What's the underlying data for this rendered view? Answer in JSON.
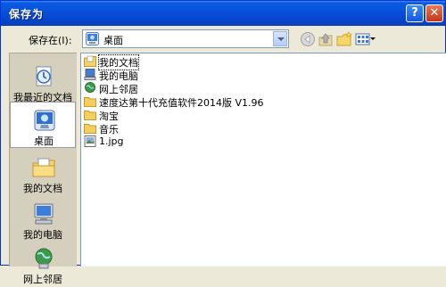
{
  "window": {
    "title": "保存为",
    "help_label": "?",
    "close_label": "✕"
  },
  "toolbar": {
    "lookin_label": "保存在(I):",
    "lookin_value": "桌面",
    "icons": [
      "back-icon",
      "up-folder-icon",
      "new-folder-icon",
      "views-menu-icon"
    ]
  },
  "places": [
    {
      "label": "我最近的文档",
      "icon": "recent-documents-icon"
    },
    {
      "label": "桌面",
      "icon": "desktop-icon",
      "selected": true
    },
    {
      "label": "我的文档",
      "icon": "my-documents-icon"
    },
    {
      "label": "我的电脑",
      "icon": "my-computer-icon"
    },
    {
      "label": "网上邻居",
      "icon": "network-places-icon"
    }
  ],
  "files": [
    {
      "label": "我的文档",
      "icon": "my-documents-folder-icon"
    },
    {
      "label": "我的电脑",
      "icon": "my-computer-icon"
    },
    {
      "label": "网上邻居",
      "icon": "network-places-icon"
    },
    {
      "label": "速度达第十代充值软件2014版 V1.96",
      "icon": "folder-icon"
    },
    {
      "label": "淘宝",
      "icon": "folder-icon"
    },
    {
      "label": "音乐",
      "icon": "folder-icon"
    },
    {
      "label": "1.jpg",
      "icon": "jpg-file-icon"
    }
  ]
}
